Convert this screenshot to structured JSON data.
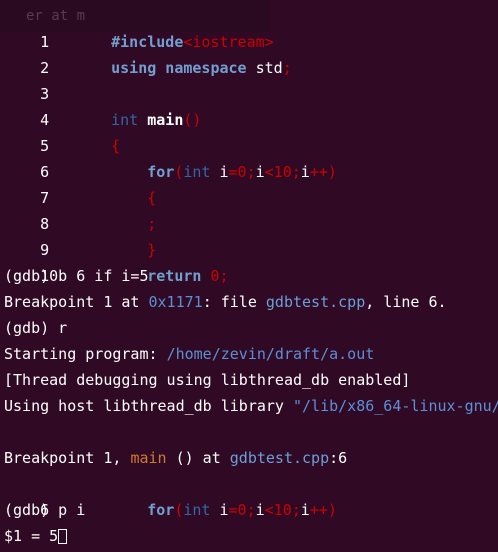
{
  "ghost_text": "er at m",
  "source_lines": [
    {
      "num": "1",
      "text": "#include<iostream>"
    },
    {
      "num": "2",
      "text": "using namespace std;"
    },
    {
      "num": "3",
      "text": ""
    },
    {
      "num": "4",
      "text": "int main()"
    },
    {
      "num": "5",
      "text": "{"
    },
    {
      "num": "6",
      "text": "for(int i=0;i<10;i++)"
    },
    {
      "num": "7",
      "text": "{"
    },
    {
      "num": "8",
      "text": ";"
    },
    {
      "num": "9",
      "text": "}"
    },
    {
      "num": "10",
      "text": "return 0;"
    }
  ],
  "src": {
    "include_kw": "#include",
    "include_hdr": "<iostream>",
    "using_kw": "using namespace",
    "using_std": " std",
    "using_semi": ";",
    "int_kw": "int",
    "main_fn": "main",
    "main_parens": "()",
    "brace_open": "{",
    "for_kw": "for",
    "for_paren": "(",
    "for_int": "int",
    "for_i1": " i",
    "for_eq0": "=0;",
    "for_i2": "i",
    "for_lt10": "<10;",
    "for_i3": "i",
    "for_inc": "++)",
    "semi": ";",
    "brace_close": "}",
    "return_kw": "return",
    "return_val": " 0;"
  },
  "session": {
    "cmd_break": "(gdb) b 6 if i=5",
    "bp_prefix": "Breakpoint 1 at ",
    "bp_addr": "0x1171",
    "bp_mid": ": file ",
    "bp_file": "gdbtest.cpp",
    "bp_suffix": ", line 6.",
    "cmd_run": "(gdb) r",
    "start_prefix": "Starting program: ",
    "start_path": "/home/zevin/draft/a.out",
    "thread_msg": "[Thread debugging using libthread_db enabled]",
    "host_prefix": "Using host libthread_db library ",
    "host_path": "\"/lib/x86_64-linux-gnu/",
    "hit_prefix": "Breakpoint 1, ",
    "hit_fn": "main",
    "hit_mid": " () at ",
    "hit_file": "gdbtest.cpp",
    "hit_line": ":6",
    "frame_num": "6",
    "cmd_print": "(gdb) p i",
    "result": "$1 = 5"
  }
}
